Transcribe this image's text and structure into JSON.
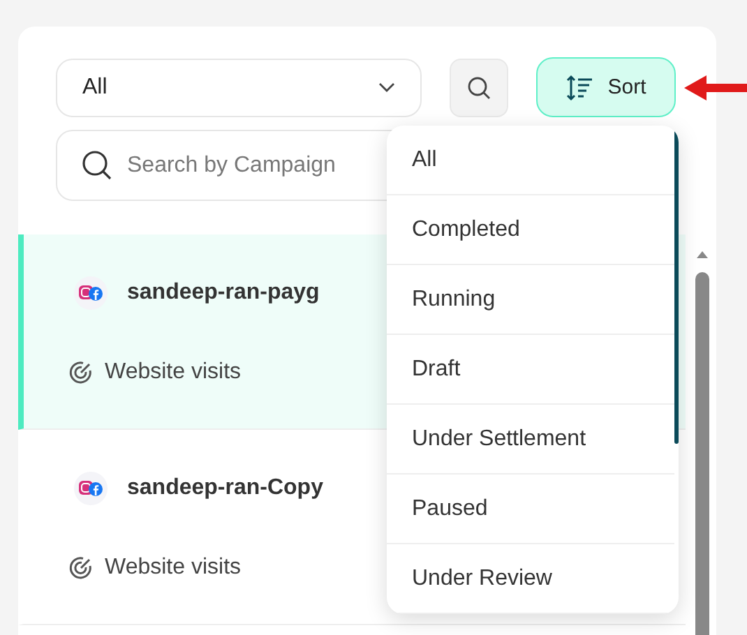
{
  "filter": {
    "value": "All"
  },
  "sort_button": {
    "label": "Sort"
  },
  "search": {
    "placeholder": "Search by Campaign"
  },
  "campaigns": [
    {
      "name": "sandeep-ran-payg",
      "objective": "Website visits",
      "selected": true
    },
    {
      "name": "sandeep-ran-Copy",
      "objective": "Website visits",
      "selected": false
    }
  ],
  "sort_menu": {
    "items": [
      "All",
      "Completed",
      "Running",
      "Draft",
      "Under Settlement",
      "Paused",
      "Under Review"
    ]
  }
}
